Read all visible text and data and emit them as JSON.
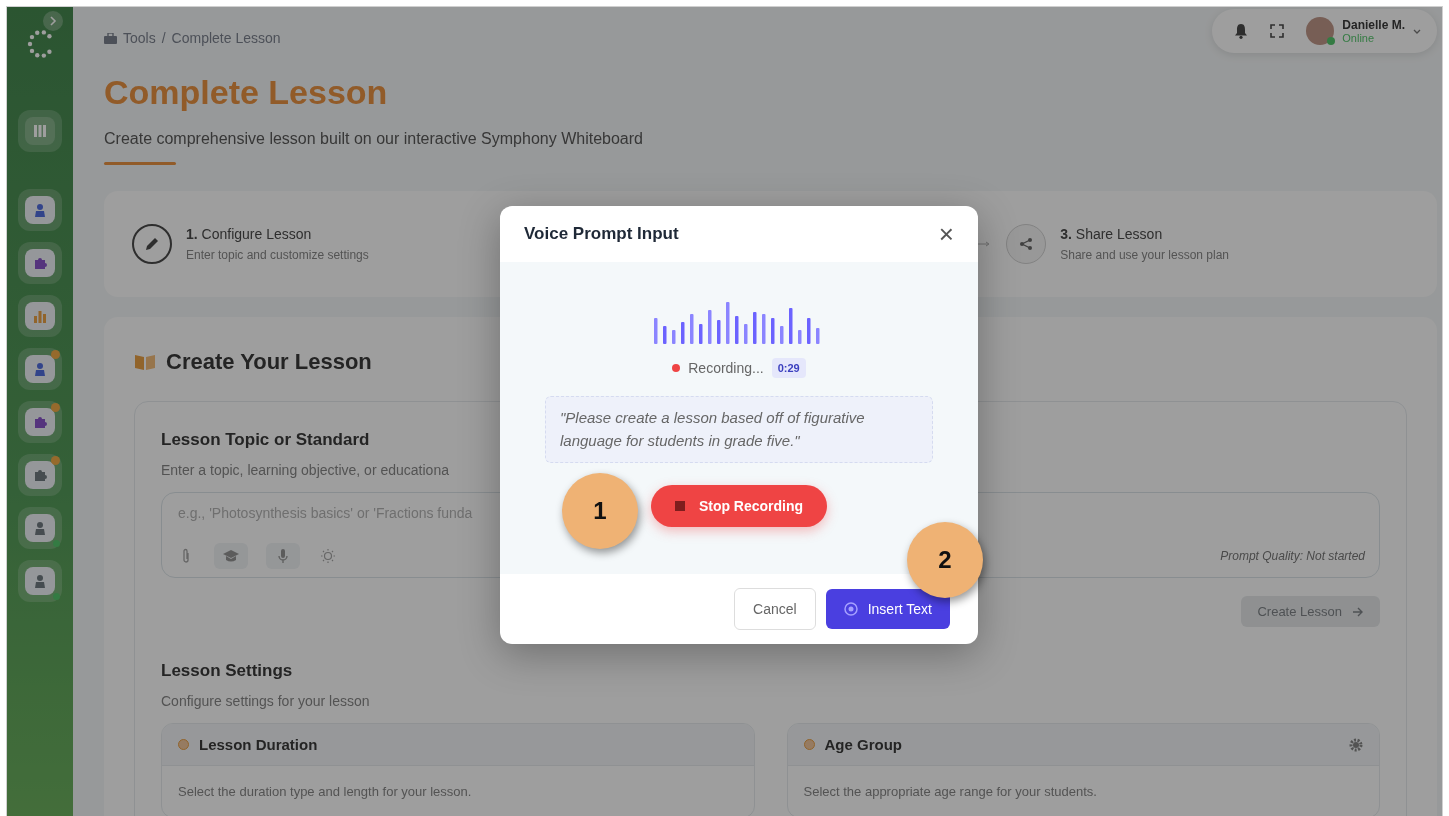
{
  "sidebar": {
    "items": [
      {
        "kind": "grid",
        "notification": false,
        "online": false
      },
      {
        "kind": "person",
        "notification": false,
        "online": false
      },
      {
        "kind": "puzzle",
        "notification": false,
        "online": false
      },
      {
        "kind": "chart",
        "notification": false,
        "online": false
      },
      {
        "kind": "person",
        "notification": true,
        "online": false
      },
      {
        "kind": "puzzle",
        "notification": true,
        "online": false
      },
      {
        "kind": "puzzle",
        "notification": true,
        "online": false
      },
      {
        "kind": "person",
        "notification": false,
        "online": true
      },
      {
        "kind": "person",
        "notification": false,
        "online": true
      }
    ]
  },
  "breadcrumb": [
    "Tools",
    "/",
    "Complete Lesson"
  ],
  "user": {
    "name": "Danielle M.",
    "status": "Online"
  },
  "page": {
    "title": "Complete Lesson",
    "subtitle": "Create comprehensive lesson built on our interactive Symphony Whiteboard"
  },
  "steps": [
    {
      "number": "1.",
      "title": "Configure Lesson",
      "description": "Enter topic and customize settings",
      "kind": "pencil"
    },
    {
      "number": "3.",
      "title": "Share Lesson",
      "description": "Share and use your lesson plan",
      "kind": "share"
    }
  ],
  "create": {
    "heading": "Create Your Lesson",
    "topic_label": "Lesson Topic or Standard",
    "topic_hint": "Enter a topic, learning objective, or educationa",
    "placeholder": "e.g., 'Photosynthesis basics' or 'Fractions funda",
    "prompt_quality": "Prompt Quality: Not started",
    "create_button": "Create Lesson",
    "create_disabled": true
  },
  "settings": {
    "heading": "Lesson Settings",
    "subtitle": "Configure settings for your lesson",
    "cards": [
      {
        "title": "Lesson Duration",
        "description": "Select the duration type and length for your lesson.",
        "gear": false
      },
      {
        "title": "Age Group",
        "description": "Select the appropriate age range for your students.",
        "gear": true
      }
    ]
  },
  "modal": {
    "title": "Voice Prompt Input",
    "close": "×",
    "status": "Recording...",
    "time": "0:29",
    "transcript": "\"Please create a lesson based off of figurative language for students in grade five.\"",
    "stop_button": "Stop Recording",
    "cancel_button": "Cancel",
    "insert_button": "Insert Text"
  },
  "callouts": [
    "1",
    "2"
  ]
}
